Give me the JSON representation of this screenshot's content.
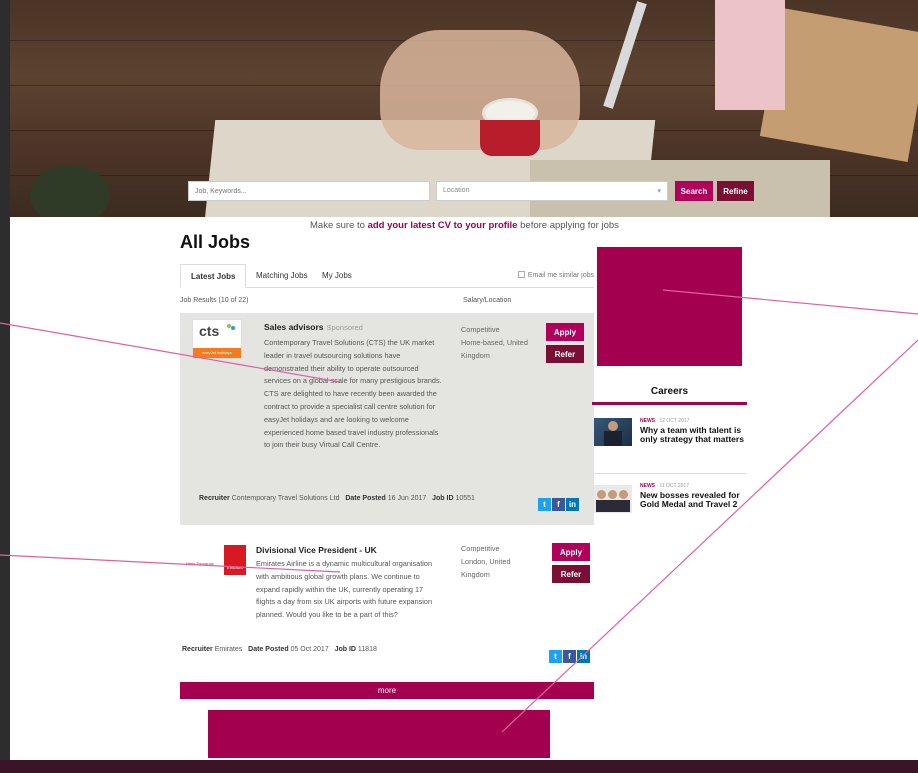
{
  "search": {
    "what_placeholder": "Job, Keywords...",
    "location_placeholder": "Location",
    "search_label": "Search",
    "refine_label": "Refine"
  },
  "notice": {
    "prefix": "Make sure to ",
    "link": "add your latest CV to your profile",
    "suffix": " before applying for jobs"
  },
  "page_title": "All Jobs",
  "tabs": [
    {
      "label": "Latest Jobs",
      "active": true
    },
    {
      "label": "Matching Jobs",
      "active": false
    },
    {
      "label": "My Jobs",
      "active": false
    }
  ],
  "email_similar_label": "Email me similar jobs",
  "results_header": {
    "count": "Job Results (10 of 22)",
    "salary_location": "Salary/Location"
  },
  "jobs": [
    {
      "title": "Sales advisors",
      "badge": "Sponsored",
      "description": "Contemporary Travel Solutions (CTS) the UK market leader in travel outsourcing solutions have demonstrated their ability to operate outsourced services on a global scale for many prestigious brands. CTS are delighted to have recently been awarded the contract to provide a specialist call centre solution for easyJet holidays and are looking to welcome experienced home based travel industry professionals to join their busy Virtual Call Centre.",
      "salary": "Competitive",
      "location": "Home-based, United Kingdom",
      "apply_label": "Apply",
      "refer_label": "Refer",
      "recruiter_label": "Recruiter",
      "recruiter": "Contemporary Travel Solutions Ltd",
      "date_label": "Date Posted",
      "date": "16 Jun 2017",
      "id_label": "Job ID",
      "id": "10551",
      "logo_text": "cts",
      "logo_sub": "easyJet holidays"
    },
    {
      "title": "Divisional Vice President - UK",
      "badge": "",
      "description": "Emirates Airline is a dynamic multicultural organisation with ambitious global growth plans. We continue to expand rapidly within the UK, currently operating 17 flights a day from six UK airports with future expansion planned. Would you like to be a part of this?",
      "salary": "Competitive",
      "location": "London, United Kingdom",
      "apply_label": "Apply",
      "refer_label": "Refer",
      "recruiter_label": "Recruiter",
      "recruiter": "Emirates",
      "date_label": "Date Posted",
      "date": "05 Oct 2017",
      "id_label": "Job ID",
      "id": "11818",
      "logo_text": "Hello Tomorrow",
      "logo_sub": "Emirates"
    }
  ],
  "more_label": "more",
  "careers": {
    "title": "Careers",
    "items": [
      {
        "tag": "NEWS",
        "date": "12 OCT 2017",
        "headline": "Why a team with talent is only strategy that matters"
      },
      {
        "tag": "NEWS",
        "date": "11 OCT 2017",
        "headline": "New bosses revealed for Gold Medal and Travel 2"
      }
    ]
  },
  "social": {
    "twitter": "t",
    "facebook": "f",
    "linkedin": "in"
  },
  "colors": {
    "brand": "#a3004f",
    "brand_dark": "#7a0f35",
    "annotation": "#e0609f",
    "frame": "#2d2d2f"
  }
}
